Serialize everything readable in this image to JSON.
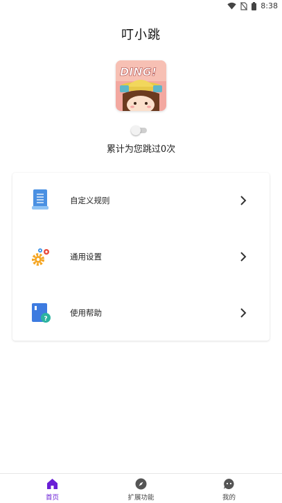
{
  "status_bar": {
    "time": "8:38",
    "icons": [
      "wifi-icon",
      "no-sim-icon",
      "battery-icon"
    ]
  },
  "header": {
    "title": "叮小跳"
  },
  "logo": {
    "text": "DING!"
  },
  "toggle": {
    "enabled": false
  },
  "stats": {
    "jump_count_text": "累计为您跳过0次"
  },
  "menu": {
    "items": [
      {
        "label": "自定义规则",
        "icon": "document-icon"
      },
      {
        "label": "通用设置",
        "icon": "gears-icon"
      },
      {
        "label": "使用帮助",
        "icon": "help-book-icon"
      }
    ]
  },
  "bottom_nav": {
    "items": [
      {
        "label": "首页",
        "icon": "home-icon",
        "active": true
      },
      {
        "label": "扩展功能",
        "icon": "compass-icon",
        "active": false
      },
      {
        "label": "我的",
        "icon": "profile-chat-icon",
        "active": false
      }
    ]
  },
  "colors": {
    "accent": "#6a1fd6",
    "doc_blue": "#4a90e2",
    "gear_orange": "#f5a623",
    "gear_red": "#e84a3c",
    "gear_blue": "#3a8ee6",
    "help_blue": "#3d7be0",
    "help_teal": "#2bb3a0"
  }
}
